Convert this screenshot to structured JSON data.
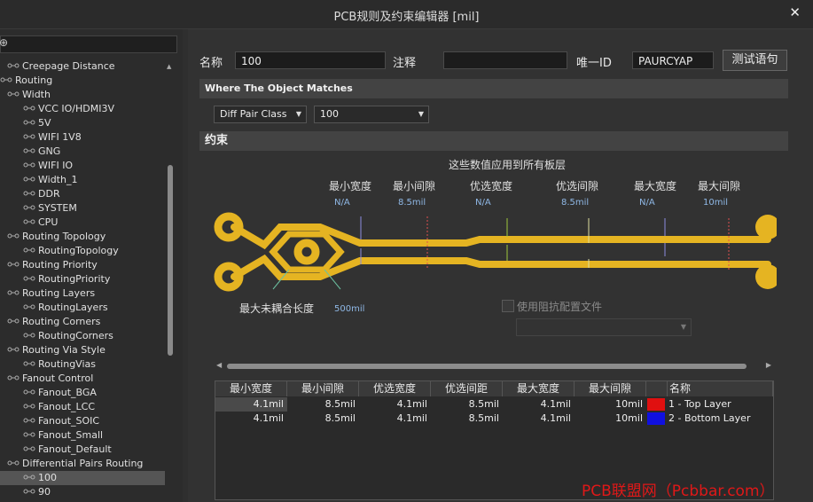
{
  "window": {
    "title": "PCB规则及约束编辑器 [mil]",
    "close": "✕"
  },
  "tree": {
    "search_glyph": "⊕",
    "items": [
      {
        "label": "Creepage Distance",
        "level": 1,
        "icon": "rule-icon"
      },
      {
        "label": "Routing",
        "level": 0,
        "icon": "folder-icon"
      },
      {
        "label": "Width",
        "level": 1,
        "icon": "rule-icon"
      },
      {
        "label": "VCC IO/HDMI3V",
        "level": 2,
        "icon": "rule-icon"
      },
      {
        "label": "5V",
        "level": 2,
        "icon": "rule-icon"
      },
      {
        "label": "WIFI 1V8",
        "level": 2,
        "icon": "rule-icon"
      },
      {
        "label": "GNG",
        "level": 2,
        "icon": "rule-icon"
      },
      {
        "label": "WIFI IO",
        "level": 2,
        "icon": "rule-icon"
      },
      {
        "label": "Width_1",
        "level": 2,
        "icon": "rule-icon"
      },
      {
        "label": "DDR",
        "level": 2,
        "icon": "rule-icon"
      },
      {
        "label": "SYSTEM",
        "level": 2,
        "icon": "rule-icon"
      },
      {
        "label": "CPU",
        "level": 2,
        "icon": "rule-icon"
      },
      {
        "label": "Routing Topology",
        "level": 1,
        "icon": "rule-icon"
      },
      {
        "label": "RoutingTopology",
        "level": 2,
        "icon": "rule-icon"
      },
      {
        "label": "Routing Priority",
        "level": 1,
        "icon": "rule-icon"
      },
      {
        "label": "RoutingPriority",
        "level": 2,
        "icon": "rule-icon"
      },
      {
        "label": "Routing Layers",
        "level": 1,
        "icon": "rule-icon"
      },
      {
        "label": "RoutingLayers",
        "level": 2,
        "icon": "rule-icon"
      },
      {
        "label": "Routing Corners",
        "level": 1,
        "icon": "rule-icon"
      },
      {
        "label": "RoutingCorners",
        "level": 2,
        "icon": "rule-icon"
      },
      {
        "label": "Routing Via Style",
        "level": 1,
        "icon": "rule-icon"
      },
      {
        "label": "RoutingVias",
        "level": 2,
        "icon": "rule-icon"
      },
      {
        "label": "Fanout Control",
        "level": 1,
        "icon": "rule-icon"
      },
      {
        "label": "Fanout_BGA",
        "level": 2,
        "icon": "rule-icon"
      },
      {
        "label": "Fanout_LCC",
        "level": 2,
        "icon": "rule-icon"
      },
      {
        "label": "Fanout_SOIC",
        "level": 2,
        "icon": "rule-icon"
      },
      {
        "label": "Fanout_Small",
        "level": 2,
        "icon": "rule-icon"
      },
      {
        "label": "Fanout_Default",
        "level": 2,
        "icon": "rule-icon"
      },
      {
        "label": "Differential Pairs Routing",
        "level": 1,
        "icon": "rule-icon"
      },
      {
        "label": "100",
        "level": 2,
        "icon": "rule-icon",
        "selected": true
      },
      {
        "label": "90",
        "level": 2,
        "icon": "rule-icon"
      }
    ]
  },
  "form": {
    "name_label": "名称",
    "name_value": "100",
    "comment_label": "注释",
    "comment_value": "",
    "uid_label": "唯一ID",
    "uid_value": "PAURCYAP",
    "test_button": "测试语句"
  },
  "where": {
    "header": "Where The Object Matches",
    "type_select": "Diff Pair Class",
    "value_select": "100"
  },
  "constraints": {
    "header": "约束",
    "note": "这些数值应用到所有板层",
    "params": [
      {
        "label": "最小宽度",
        "value": "N/A"
      },
      {
        "label": "最小间隙",
        "value": "8.5mil"
      },
      {
        "label": "优选宽度",
        "value": "N/A"
      },
      {
        "label": "优选间隙",
        "value": "8.5mil"
      },
      {
        "label": "最大宽度",
        "value": "N/A"
      },
      {
        "label": "最大间隙",
        "value": "10mil"
      }
    ],
    "uncoupled_label": "最大未耦合长度",
    "uncoupled_value": "500mil",
    "impedance_label": "使用阻抗配置文件",
    "impedance_select": ""
  },
  "layers_table": {
    "headers": [
      "最小宽度",
      "最小间隙",
      "优选宽度",
      "优选间距",
      "最大宽度",
      "最大间隙",
      "",
      "名称"
    ],
    "rows": [
      {
        "values": [
          "4.1mil",
          "8.5mil",
          "4.1mil",
          "8.5mil",
          "4.1mil",
          "10mil"
        ],
        "color": "#e01010",
        "name": "1 - Top Layer"
      },
      {
        "values": [
          "4.1mil",
          "8.5mil",
          "4.1mil",
          "8.5mil",
          "4.1mil",
          "10mil"
        ],
        "color": "#1010e0",
        "name": "2 - Bottom Layer"
      }
    ]
  },
  "watermark": "PCB联盟网（Pcbbar.com）",
  "colors": {
    "trace": "#e5b422",
    "arrow_blue": "#8c8ce0",
    "arrow_green": "#9fc83c",
    "arrow_red": "#e05050"
  }
}
